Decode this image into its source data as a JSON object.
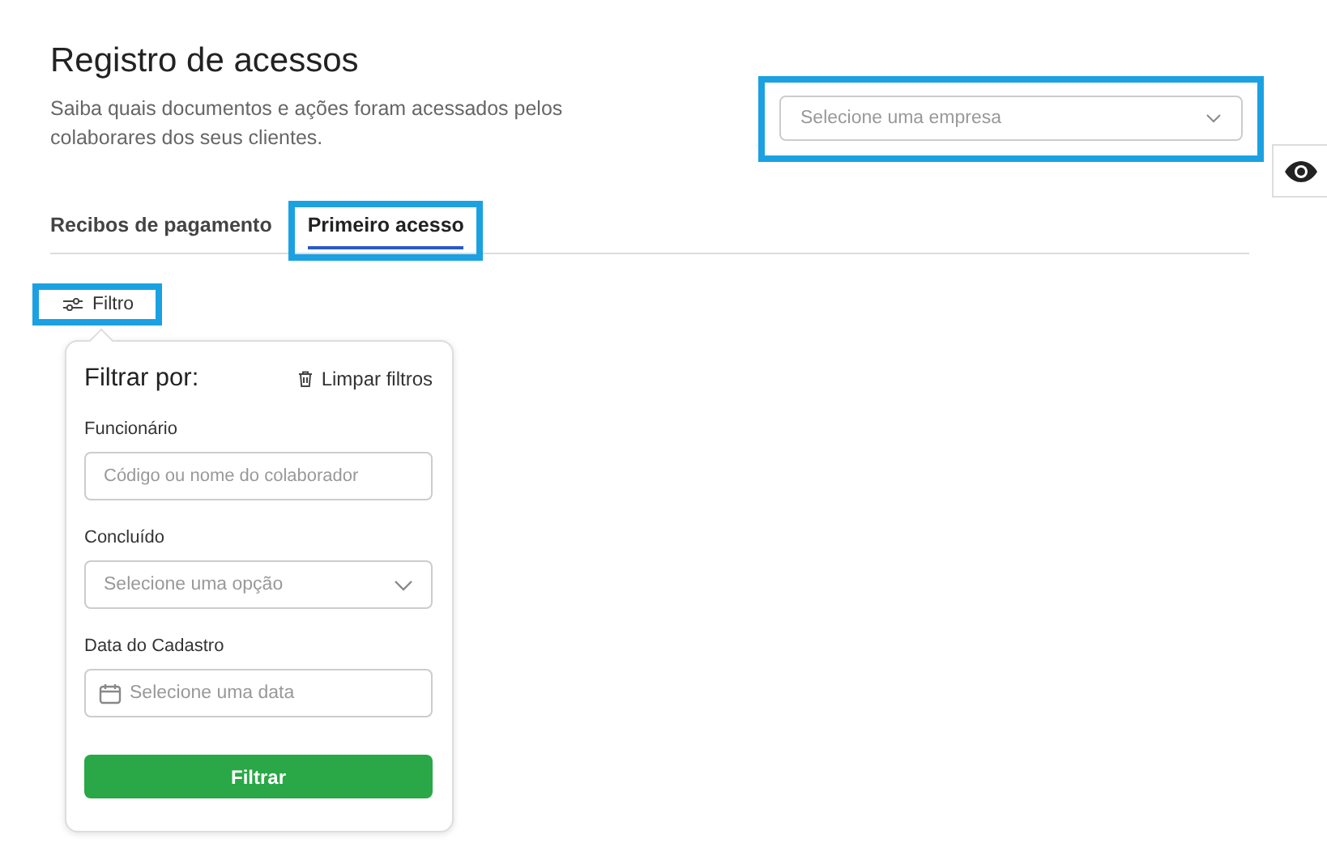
{
  "header": {
    "title": "Registro de acessos",
    "description": "Saiba quais documentos e ações foram acessados pelos colaborares dos seus clientes."
  },
  "company_select": {
    "placeholder": "Selecione uma empresa",
    "highlighted": true
  },
  "tabs": [
    {
      "label": "Recibos de pagamento",
      "selected": false,
      "highlighted": false
    },
    {
      "label": "Primeiro acesso",
      "selected": true,
      "highlighted": true
    }
  ],
  "filter_button": {
    "label": "Filtro",
    "highlighted": true
  },
  "filter_panel": {
    "title": "Filtrar por:",
    "clear": "Limpar filtros",
    "fields": [
      {
        "kind": "text",
        "label": "Funcionário",
        "placeholder": "Código ou nome do colaborador"
      },
      {
        "kind": "select",
        "label": "Concluído",
        "placeholder": "Selecione uma opção"
      },
      {
        "kind": "date",
        "label": "Data do Cadastro",
        "placeholder": "Selecione uma data"
      }
    ],
    "submit": "Filtrar"
  }
}
